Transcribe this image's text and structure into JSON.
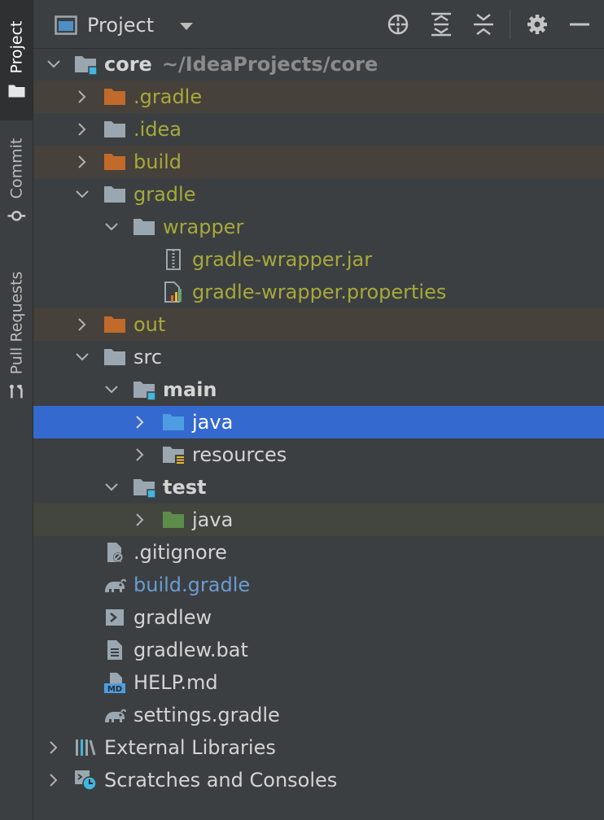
{
  "tool_strip": {
    "project_label": "Project",
    "commit_label": "Commit",
    "pull_requests_label": "Pull Requests"
  },
  "header": {
    "title": "Project",
    "icons": [
      "locate-icon",
      "expand-all-icon",
      "collapse-all-icon",
      "settings-gear-icon",
      "hide-minus-icon"
    ]
  },
  "tree": {
    "root_name": "core",
    "root_path": "~/IdeaProjects/core",
    "gradle_dot": ".gradle",
    "idea": ".idea",
    "build": "build",
    "gradle": "gradle",
    "wrapper": "wrapper",
    "wrapper_jar": "gradle-wrapper.jar",
    "wrapper_properties": "gradle-wrapper.properties",
    "out": "out",
    "src": "src",
    "main": "main",
    "main_java": "java",
    "resources": "resources",
    "test": "test",
    "test_java": "java",
    "gitignore": ".gitignore",
    "build_gradle": "build.gradle",
    "gradlew": "gradlew",
    "gradlew_bat": "gradlew.bat",
    "help_md": "HELP.md",
    "settings_gradle": "settings.gradle",
    "external_libraries": "External Libraries",
    "scratches": "Scratches and Consoles"
  },
  "selected_item": "java",
  "colors": {
    "background": "#3c3f41",
    "selection": "#3469cf",
    "excluded_row": "#46413b",
    "test_row": "#42463f",
    "excluded_folder": "#c26a2a",
    "ignored_text": "#a7a93a",
    "modified_text": "#6b9bd2"
  }
}
